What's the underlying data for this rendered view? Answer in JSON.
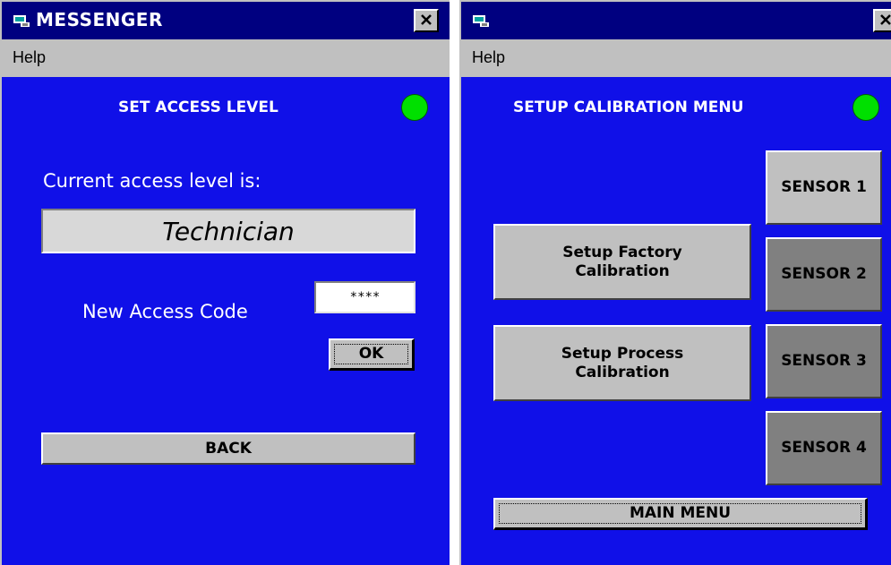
{
  "left_window": {
    "title": "MESSENGER",
    "menu": {
      "help": "Help"
    },
    "screen_title": "SET ACCESS LEVEL",
    "current_level_label": "Current access level is:",
    "current_level_value": "Technician",
    "new_code_label": "New Access Code",
    "new_code_value": "****",
    "ok_label": "OK",
    "back_label": "BACK"
  },
  "right_window": {
    "title": "",
    "menu": {
      "help": "Help"
    },
    "screen_title": "SETUP CALIBRATION MENU",
    "factory_label": "Setup Factory Calibration",
    "process_label": "Setup Process Calibration",
    "sensors": [
      "SENSOR 1",
      "SENSOR 2",
      "SENSOR 3",
      "SENSOR 4"
    ],
    "main_menu_label": "MAIN MENU"
  },
  "colors": {
    "screen_bg": "#1010e8",
    "titlebar": "#000080",
    "status_led": "#00e000",
    "button_face": "#c0c0c0",
    "button_dark": "#808080"
  },
  "icons": {
    "app_icon": "app-icon",
    "close_icon": "close-icon",
    "status_led": "status-led-icon"
  }
}
